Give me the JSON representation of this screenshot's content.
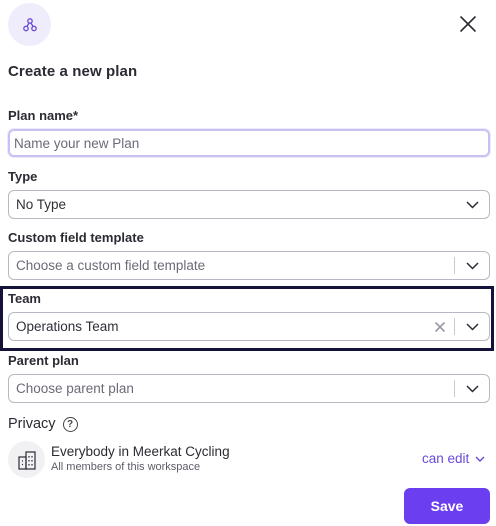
{
  "dialog": {
    "title": "Create a new plan",
    "save_label": "Save"
  },
  "plan_name": {
    "label": "Plan name*",
    "value": "",
    "placeholder": "Name your new Plan"
  },
  "type": {
    "label": "Type",
    "selected": "No Type"
  },
  "custom_field_template": {
    "label": "Custom field template",
    "placeholder": "Choose a custom field template"
  },
  "team": {
    "label": "Team",
    "selected": "Operations Team"
  },
  "parent_plan": {
    "label": "Parent plan",
    "placeholder": "Choose parent plan"
  },
  "privacy": {
    "label": "Privacy",
    "help_glyph": "?",
    "access_name": "Everybody in Meerkat Cycling",
    "access_description": "All members of this workspace",
    "permission": "can edit"
  },
  "colors": {
    "accent": "#6b3ff0",
    "highlight_border": "#15123a"
  }
}
